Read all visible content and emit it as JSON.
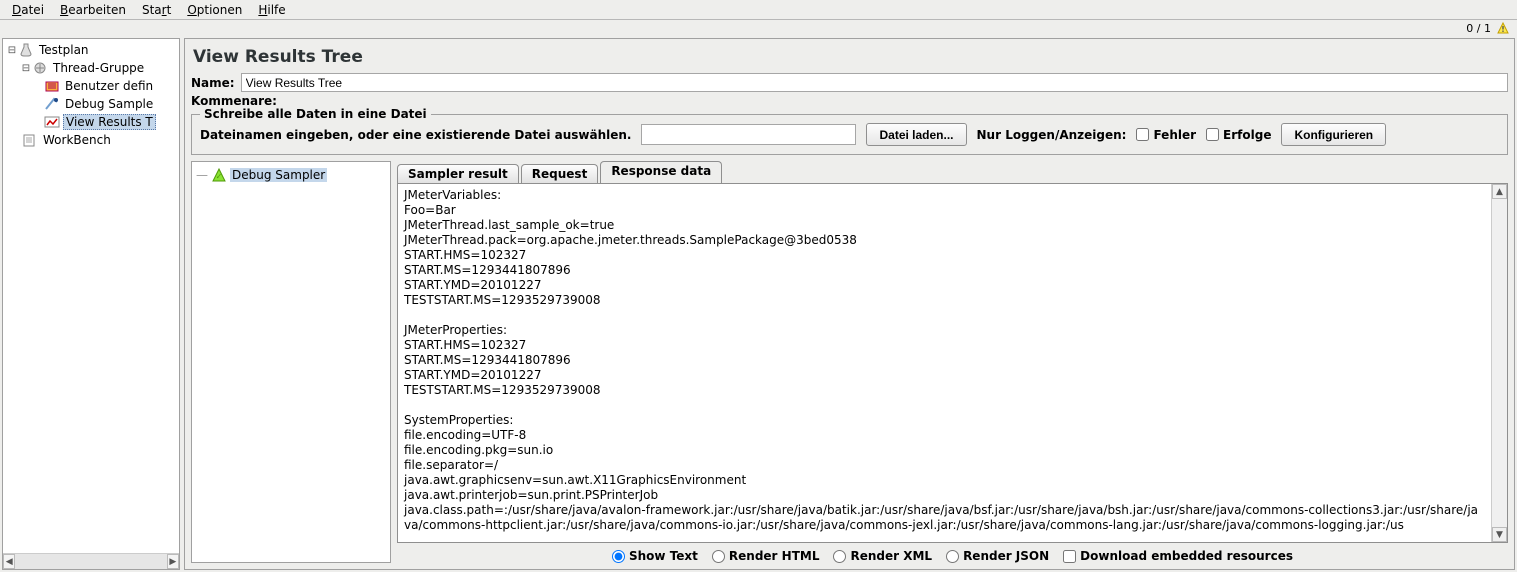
{
  "menubar": [
    "Datei",
    "Bearbeiten",
    "Start",
    "Optionen",
    "Hilfe"
  ],
  "counter": "0 / 1",
  "tree": {
    "testplan": "Testplan",
    "thread_group": "Thread-Gruppe",
    "user_vars": "Benutzer defin",
    "debug_sampler": "Debug Sample",
    "view_results": "View Results T",
    "workbench": "WorkBench"
  },
  "panel": {
    "title": "View Results Tree",
    "name_label": "Name:",
    "name_value": "View Results Tree",
    "comment_label": "Kommenare:"
  },
  "file_box": {
    "legend": "Schreibe alle Daten in eine Datei",
    "prompt": "Dateinamen eingeben, oder eine existierende Datei auswählen.",
    "filename_value": "",
    "load_button": "Datei laden...",
    "only_label": "Nur Loggen/Anzeigen:",
    "errors": "Fehler",
    "success": "Erfolge",
    "configure": "Konfigurieren"
  },
  "result_tree": {
    "item": "Debug Sampler"
  },
  "tabs": [
    "Sampler result",
    "Request",
    "Response data"
  ],
  "response_text": "JMeterVariables:\nFoo=Bar\nJMeterThread.last_sample_ok=true\nJMeterThread.pack=org.apache.jmeter.threads.SamplePackage@3bed0538\nSTART.HMS=102327\nSTART.MS=1293441807896\nSTART.YMD=20101227\nTESTSTART.MS=1293529739008\n\nJMeterProperties:\nSTART.HMS=102327\nSTART.MS=1293441807896\nSTART.YMD=20101227\nTESTSTART.MS=1293529739008\n\nSystemProperties:\nfile.encoding=UTF-8\nfile.encoding.pkg=sun.io\nfile.separator=/\njava.awt.graphicsenv=sun.awt.X11GraphicsEnvironment\njava.awt.printerjob=sun.print.PSPrinterJob\njava.class.path=:/usr/share/java/avalon-framework.jar:/usr/share/java/batik.jar:/usr/share/java/bsf.jar:/usr/share/java/bsh.jar:/usr/share/java/commons-collections3.jar:/usr/share/java/commons-httpclient.jar:/usr/share/java/commons-io.jar:/usr/share/java/commons-jexl.jar:/usr/share/java/commons-lang.jar:/usr/share/java/commons-logging.jar:/us",
  "render": {
    "show_text": "Show Text",
    "render_html": "Render HTML",
    "render_xml": "Render XML",
    "render_json": "Render JSON",
    "download": "Download embedded resources"
  }
}
